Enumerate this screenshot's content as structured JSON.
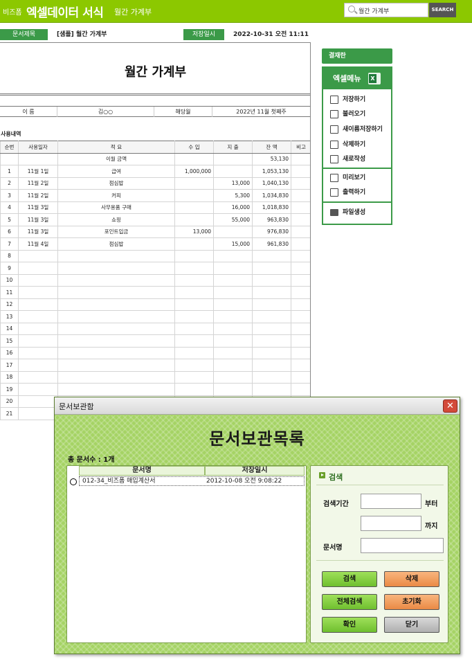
{
  "topbar": {
    "brand_small": "비즈폼",
    "brand_main": "엑셀데이터 서식",
    "brand_sub": "월간 가계부",
    "search_value": "월간 가계부",
    "search_button": "SEARCH"
  },
  "doc_info": {
    "title_label": "문서제목",
    "title_value": "[샘플] 월간 가계부",
    "saved_label": "저장일시",
    "saved_value": "2022-10-31  오전 11:11"
  },
  "sheet": {
    "title": "월간 가계부",
    "name_label": "이 름",
    "name_value": "김○○",
    "month_label": "해당월",
    "month_value": "2022년 11월 첫째주",
    "section_label": "사용내역",
    "columns": [
      "순번",
      "사용일자",
      "적 요",
      "수 입",
      "지 출",
      "잔 액",
      "비고"
    ],
    "carry_over": {
      "label": "이월 금액",
      "balance": "53,130"
    },
    "rows": [
      {
        "no": "1",
        "date": "11월 1일",
        "desc": "급여",
        "income": "1,000,000",
        "expense": "",
        "balance": "1,053,130"
      },
      {
        "no": "2",
        "date": "11월 2일",
        "desc": "점심밥",
        "income": "",
        "expense": "13,000",
        "balance": "1,040,130"
      },
      {
        "no": "3",
        "date": "11월 2일",
        "desc": "커피",
        "income": "",
        "expense": "5,300",
        "balance": "1,034,830"
      },
      {
        "no": "4",
        "date": "11월 3일",
        "desc": "사무용품 구매",
        "income": "",
        "expense": "16,000",
        "balance": "1,018,830"
      },
      {
        "no": "5",
        "date": "11월 3일",
        "desc": "쇼핑",
        "income": "",
        "expense": "55,000",
        "balance": "963,830"
      },
      {
        "no": "6",
        "date": "11월 3일",
        "desc": "포인트입금",
        "income": "13,000",
        "expense": "",
        "balance": "976,830"
      },
      {
        "no": "7",
        "date": "11월 4일",
        "desc": "점심밥",
        "income": "",
        "expense": "15,000",
        "balance": "961,830"
      },
      {
        "no": "8",
        "date": "",
        "desc": "",
        "income": "",
        "expense": "",
        "balance": ""
      },
      {
        "no": "9",
        "date": "",
        "desc": "",
        "income": "",
        "expense": "",
        "balance": ""
      },
      {
        "no": "10",
        "date": "",
        "desc": "",
        "income": "",
        "expense": "",
        "balance": ""
      },
      {
        "no": "11",
        "date": "",
        "desc": "",
        "income": "",
        "expense": "",
        "balance": ""
      },
      {
        "no": "12",
        "date": "",
        "desc": "",
        "income": "",
        "expense": "",
        "balance": ""
      },
      {
        "no": "13",
        "date": "",
        "desc": "",
        "income": "",
        "expense": "",
        "balance": ""
      },
      {
        "no": "14",
        "date": "",
        "desc": "",
        "income": "",
        "expense": "",
        "balance": ""
      },
      {
        "no": "15",
        "date": "",
        "desc": "",
        "income": "",
        "expense": "",
        "balance": ""
      },
      {
        "no": "16",
        "date": "",
        "desc": "",
        "income": "",
        "expense": "",
        "balance": ""
      },
      {
        "no": "17",
        "date": "",
        "desc": "",
        "income": "",
        "expense": "",
        "balance": ""
      },
      {
        "no": "18",
        "date": "",
        "desc": "",
        "income": "",
        "expense": "",
        "balance": ""
      },
      {
        "no": "19",
        "date": "",
        "desc": "",
        "income": "",
        "expense": "",
        "balance": ""
      },
      {
        "no": "20",
        "date": "",
        "desc": "",
        "income": "",
        "expense": "",
        "balance": ""
      },
      {
        "no": "21",
        "date": "",
        "desc": "",
        "income": "",
        "expense": "",
        "balance": ""
      }
    ]
  },
  "side_menu": {
    "approval_label": "결재란",
    "header": "엑셀메뉴",
    "excel_badge": "X",
    "items": [
      {
        "label": "저장하기",
        "icon": "save-icon"
      },
      {
        "label": "불러오기",
        "icon": "load-icon"
      },
      {
        "label": "새이름저장하기",
        "icon": "save-as-icon"
      },
      {
        "label": "삭제하기",
        "icon": "trash-icon"
      },
      {
        "label": "새로작성",
        "icon": "new-document-icon"
      },
      {
        "label": "미리보기",
        "icon": "preview-icon"
      },
      {
        "label": "출력하기",
        "icon": "print-icon"
      },
      {
        "label": "파일생성",
        "icon": "folder-icon"
      }
    ]
  },
  "dialog": {
    "window_title": "문서보관함",
    "close_glyph": "✕",
    "heading": "문서보관목록",
    "total_count": "총 문서수 : 1개",
    "columns": [
      "문서명",
      "저장일시"
    ],
    "documents": [
      {
        "name": "012-34_비즈폼 매입계산서",
        "saved": "2012-10-08 오전 9:08:22"
      }
    ],
    "search": {
      "title": "검색",
      "period_label": "검색기간",
      "from_suffix": "부터",
      "to_suffix": "까지",
      "docname_label": "문서명",
      "from_value": "",
      "to_value": "",
      "docname_value": ""
    },
    "buttons": {
      "search": "검색",
      "delete": "삭제",
      "search_all": "전체검색",
      "reset": "초기화",
      "confirm": "확인",
      "close": "닫기"
    }
  }
}
